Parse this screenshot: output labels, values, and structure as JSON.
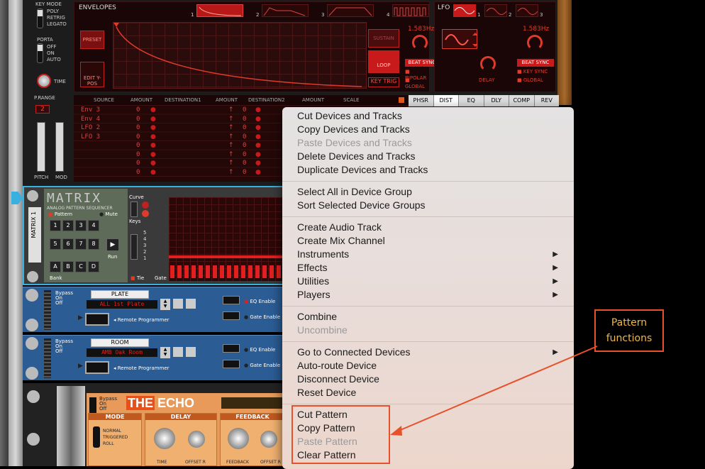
{
  "synth": {
    "key_mode_label": "KEY MODE",
    "key_modes": [
      "POLY",
      "RETRIG",
      "LEGATO"
    ],
    "porta_label": "PORTA",
    "porta_modes": [
      "OFF",
      "ON",
      "AUTO"
    ],
    "time_label": "TIME",
    "prange_label": "P.RANGE",
    "prange_value": "2",
    "pitch_label": "PITCH",
    "mod_label": "MOD",
    "envelopes_title": "ENVELOPES",
    "env_tabs": [
      "1",
      "2",
      "3",
      "4"
    ],
    "preset_button": "PRESET",
    "edit_ypos_button": "EDIT Y-POS",
    "sustain_label": "SUSTAIN",
    "loop_button": "LOOP",
    "key_trig_button": "KEY TRIG",
    "env_rate": "1.583Hz",
    "beat_sync": "BEAT SYNC",
    "bipolar": "BIPOLAR",
    "global": "GLOBAL",
    "lfo_title": "LFO",
    "lfo_tabs": [
      "1",
      "2",
      "3"
    ],
    "lfo_rate": "1.583Hz",
    "lfo_beat_sync": "BEAT SYNC",
    "delay_label": "DELAY",
    "key_sync": "KEY SYNC",
    "lfo_global": "GLOBAL",
    "mod_headers": [
      "SOURCE",
      "AMOUNT",
      "DESTINATION1",
      "AMOUNT",
      "DESTINATION2",
      "AMOUNT",
      "SCALE"
    ],
    "mod_sources": [
      "Env 3",
      "Env 4",
      "LFO 2",
      "LFO 3",
      "",
      "",
      "",
      ""
    ],
    "mod_amounts": [
      "0",
      "0",
      "0",
      "0",
      "0",
      "0",
      "0",
      "0"
    ],
    "fx_tabs": [
      "PHSR",
      "DIST",
      "EQ",
      "DLY",
      "COMP",
      "REV"
    ]
  },
  "matrix": {
    "title": "MATRIX",
    "subtitle": "ANALOG PATTERN SEQUENCER",
    "pattern_label": "Pattern",
    "mute_label": "Mute",
    "name_label": "MATRIX 1",
    "keys": [
      "1",
      "2",
      "3",
      "4",
      "5",
      "6",
      "7",
      "8"
    ],
    "banks": [
      "A",
      "B",
      "C",
      "D"
    ],
    "bank_label": "Bank",
    "run_label": "Run",
    "curve_label": "Curve",
    "keys_label": "Keys",
    "tie_label": "Tie",
    "gate_label": "Gate",
    "octaves": [
      "5",
      "4",
      "3",
      "2",
      "1"
    ]
  },
  "combi1": {
    "bypass": "Bypass",
    "on": "On",
    "off": "Off",
    "name": "PLATE",
    "patch": "ALL 1st Plate",
    "remote": "Remote Programmer",
    "eq_enable": "EQ Enable",
    "gate_enable": "Gate Enable"
  },
  "combi2": {
    "bypass": "Bypass",
    "on": "On",
    "off": "Off",
    "name": "ROOM",
    "patch": "AMB Oak Room",
    "remote": "Remote Programmer",
    "eq_enable": "EQ Enable",
    "gate_enable": "Gate Enable"
  },
  "echo": {
    "bypass": "Bypass",
    "on": "On",
    "off": "Off",
    "logo_the": "THE",
    "logo_echo": "ECHO",
    "mode_label": "MODE",
    "modes": [
      "NORMAL",
      "TRIGGERED",
      "ROLL"
    ],
    "delay_label": "DELAY",
    "feedback_label": "FEEDBACK",
    "time_label": "TIME",
    "offset_r_label": "OFFSET R",
    "feedback_knob": "FEEDBACK",
    "offset_r2": "OFFSET R"
  },
  "menu": {
    "group1": [
      "Cut Devices and Tracks",
      "Copy Devices and Tracks",
      "Paste Devices and Tracks",
      "Delete Devices and Tracks",
      "Duplicate Devices and Tracks"
    ],
    "group2": [
      "Select All in Device Group",
      "Sort Selected Device Groups"
    ],
    "group3": [
      "Create Audio Track",
      "Create Mix Channel",
      "Instruments",
      "Effects",
      "Utilities",
      "Players"
    ],
    "group4": [
      "Combine",
      "Uncombine"
    ],
    "group5": [
      "Go to Connected Devices",
      "Auto-route Device",
      "Disconnect Device",
      "Reset Device"
    ],
    "group6": [
      "Cut Pattern",
      "Copy Pattern",
      "Paste Pattern",
      "Clear Pattern"
    ],
    "submenu_arrow": "▶"
  },
  "annotation": {
    "line1": "Pattern",
    "line2": "functions",
    "color": "#e8502a"
  }
}
